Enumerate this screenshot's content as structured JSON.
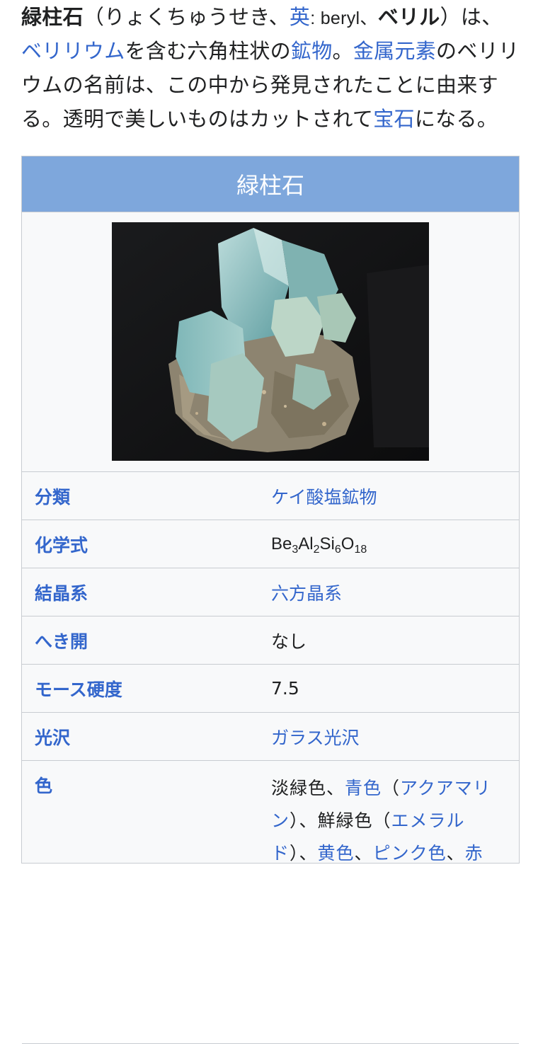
{
  "intro": {
    "line1": {
      "term": "緑柱石",
      "reading": "（りょくちゅうせき、",
      "lang_link": "英",
      "english": ": beryl、",
      "alt_name": "ベリル",
      "tail": "）は、"
    },
    "line2": {
      "beryllium_link": "ベリリウム",
      "text1": "を含む六角柱状の",
      "mineral_link": "鉱物",
      "text2": "。",
      "metal_link": "金属元素",
      "text3": "のベリリ"
    },
    "line3": "ウムの名前は、この中から発見されたことに由来す",
    "line4": {
      "text1": "る。透明で美しいものはカットされて",
      "gem_link": "宝石",
      "text2": "になる。"
    }
  },
  "infobox": {
    "title": "緑柱石",
    "rows": [
      {
        "label": "分類",
        "value": "ケイ酸塩鉱物"
      },
      {
        "label": "化学式"
      },
      {
        "label": "結晶系",
        "value": "六方晶系"
      },
      {
        "label": "へき開",
        "value": "なし"
      },
      {
        "label": "モース硬度",
        "value": "7.5"
      },
      {
        "label": "光沢",
        "value": "ガラス光沢"
      },
      {
        "label": "色"
      }
    ],
    "formula": {
      "be": "Be",
      "be_n": "3",
      "al": "Al",
      "al_n": "2",
      "si": "Si",
      "si_n": "6",
      "o": "O",
      "o_n": "18"
    },
    "color_value": {
      "t1": "淡緑色、",
      "l1": "青色",
      "t2": "（",
      "l2": "アクアマリ",
      "l2b": "ン",
      "t3": "）、鮮緑色（",
      "l3": "エメラル",
      "l3b": "ド",
      "t4": "）、",
      "l4": "黄色",
      "t5": "、",
      "l5": "ピンク色",
      "t6": "、",
      "l6": "赤"
    }
  },
  "colors": {
    "link": "#3366cc",
    "header_bg": "#7ea7dc",
    "infobox_bg": "#f8f9fa",
    "border": "#c8ccd1"
  }
}
